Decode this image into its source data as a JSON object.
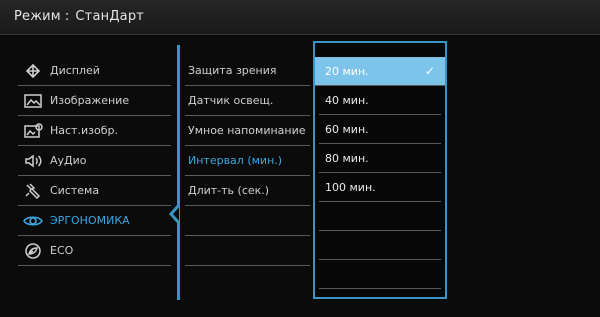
{
  "header": {
    "mode_label": "Режим",
    "separator": ":",
    "mode_value": "СтанДарт"
  },
  "left_menu": [
    {
      "label": "Дисплей",
      "icon": "display-icon"
    },
    {
      "label": "Изображение",
      "icon": "picture-icon"
    },
    {
      "label": "Наст.изобр.",
      "icon": "picture-advanced-icon"
    },
    {
      "label": "АуДио",
      "icon": "speaker-icon"
    },
    {
      "label": "Система",
      "icon": "wrench-icon"
    },
    {
      "label": "ЭРГОНОМИКА",
      "icon": "eye-icon",
      "active": true
    },
    {
      "label": "ECO",
      "icon": "leaf-icon"
    }
  ],
  "mid_menu": [
    {
      "label": "Защита зрения"
    },
    {
      "label": "Датчик освещ."
    },
    {
      "label": "Умное напоминание"
    },
    {
      "label": "Интервал (мин.)",
      "active": true
    },
    {
      "label": "Длит-ть (сек.)"
    },
    {
      "label": ""
    },
    {
      "label": ""
    }
  ],
  "submenu": {
    "options": [
      "20 мин.",
      "40 мин.",
      "60 мин.",
      "80 мин.",
      "100 мин.",
      "",
      "",
      ""
    ],
    "selected_index": 0,
    "check_mark": "✓"
  },
  "colors": {
    "accent": "#3a94c8",
    "highlight": "#7cc4ea",
    "active_text": "#3aa7e3"
  }
}
